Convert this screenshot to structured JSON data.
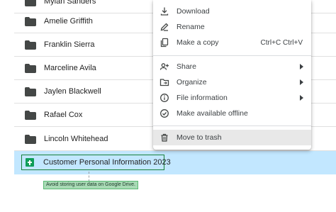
{
  "files": {
    "partial_top": "Mylan Sanders",
    "folders": [
      "Amelie Griffith",
      "Franklin Sierra",
      "Marceline Avila",
      "Jaylen Blackwell",
      "Rafael Cox",
      "Lincoln Whitehead"
    ],
    "selected_file": "Customer Personal Information 2023",
    "warning": "Avoid storing user data on Google Drive."
  },
  "menu": {
    "download": "Download",
    "rename": "Rename",
    "make_copy": "Make a copy",
    "make_copy_shortcut": "Ctrl+C Ctrl+V",
    "share": "Share",
    "organize": "Organize",
    "file_information": "File information",
    "make_offline": "Make available offline",
    "move_to_trash": "Move to trash"
  },
  "colors": {
    "selected_row": "#c2e7ff",
    "sheets_green": "#0f9d58",
    "warning_bg": "#a8dab5",
    "hover": "#e8e8e8"
  }
}
